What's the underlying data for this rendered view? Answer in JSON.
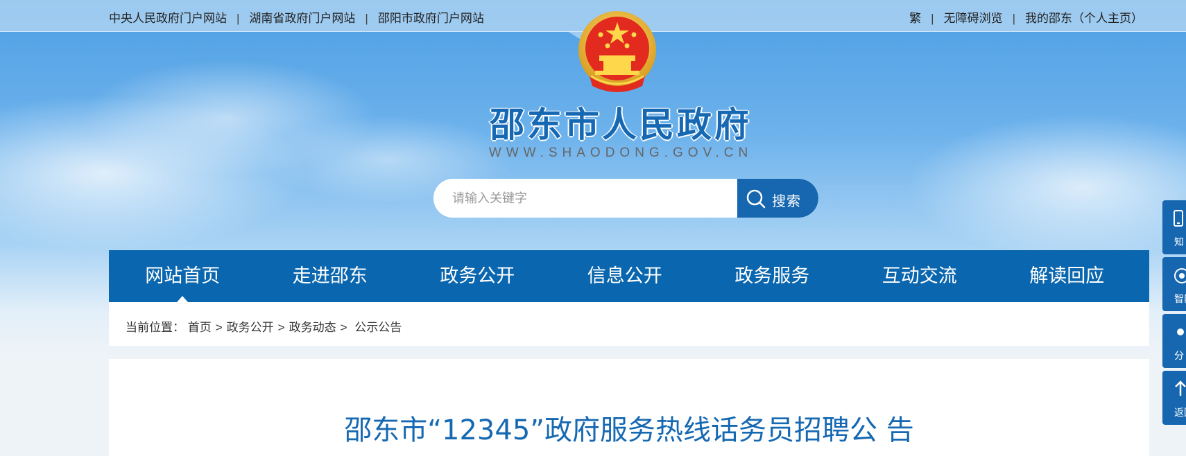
{
  "topbar": {
    "left_links": [
      "中央人民政府门户网站",
      "湖南省政府门户网站",
      "邵阳市政府门户网站"
    ],
    "right_links": [
      "繁",
      "无障碍浏览",
      "我的邵东（个人主页）"
    ],
    "separator": "|"
  },
  "header": {
    "site_title": "邵东市人民政府",
    "site_url": "WWW.SHAODONG.GOV.CN",
    "emblem_icon": "national-emblem-icon"
  },
  "search": {
    "placeholder": "请输入关键字",
    "button_label": "搜索"
  },
  "nav": {
    "items": [
      "网站首页",
      "走进邵东",
      "政务公开",
      "信息公开",
      "政务服务",
      "互动交流",
      "解读回应"
    ],
    "active_index": 0
  },
  "breadcrumb": {
    "prefix": "当前位置：",
    "items": [
      "首页",
      "政务公开",
      "政务动态",
      "公示公告"
    ],
    "separator": ">"
  },
  "article": {
    "title": "邵东市“12345”政府服务热线话务员招聘公 告"
  },
  "sidebar": {
    "items": [
      {
        "label": "知",
        "icon": "phone-icon"
      },
      {
        "label": "智能",
        "icon": "robot-icon"
      },
      {
        "label": "分",
        "icon": "share-icon"
      },
      {
        "label": "返回",
        "icon": "arrow-up-icon"
      }
    ]
  },
  "colors": {
    "primary": "#0a66ae",
    "title": "#1568b2",
    "sky_top": "#4e9fe3"
  }
}
